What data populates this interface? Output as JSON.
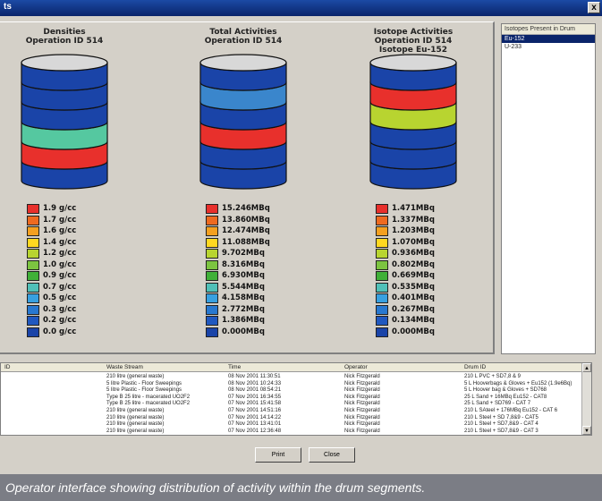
{
  "window": {
    "title": "ts",
    "close_label": "x"
  },
  "colors": {
    "drum_blue": "#1a44a8",
    "teal": "#55c8a0",
    "red": "#e8302c",
    "light_blue": "#3a86cc",
    "yellow_green": "#b8d430",
    "scale": [
      "#e8302c",
      "#ee6a20",
      "#f4a020",
      "#ffd820",
      "#b8d430",
      "#7cc440",
      "#40b038",
      "#50c0b8",
      "#38a0e0",
      "#2878d0",
      "#2058c0",
      "#1a44a8"
    ]
  },
  "charts": [
    {
      "title_lines": [
        "Densities",
        "Operation ID 514"
      ],
      "segment_colors": [
        "#1a44a8",
        "#1a44a8",
        "#1a44a8",
        "#55c8a0",
        "#e8302c",
        "#1a44a8"
      ],
      "legend": [
        "1.9 g/cc",
        "1.7 g/cc",
        "1.6 g/cc",
        "1.4 g/cc",
        "1.2 g/cc",
        "1.0 g/cc",
        "0.9 g/cc",
        "0.7 g/cc",
        "0.5 g/cc",
        "0.3 g/cc",
        "0.2 g/cc",
        "0.0 g/cc"
      ]
    },
    {
      "title_lines": [
        "Total Activities",
        "Operation ID 514"
      ],
      "segment_colors": [
        "#1a44a8",
        "#3a86cc",
        "#1a44a8",
        "#e8302c",
        "#1a44a8",
        "#1a44a8"
      ],
      "legend": [
        "15.246MBq",
        "13.860MBq",
        "12.474MBq",
        "11.088MBq",
        "9.702MBq",
        "8.316MBq",
        "6.930MBq",
        "5.544MBq",
        "4.158MBq",
        "2.772MBq",
        "1.386MBq",
        "0.000MBq"
      ]
    },
    {
      "title_lines": [
        "Isotope Activities",
        "Operation ID 514",
        "Isotope Eu-152"
      ],
      "segment_colors": [
        "#1a44a8",
        "#e8302c",
        "#b8d430",
        "#1a44a8",
        "#1a44a8",
        "#1a44a8"
      ],
      "legend": [
        "1.471MBq",
        "1.337MBq",
        "1.203MBq",
        "1.070MBq",
        "0.936MBq",
        "0.802MBq",
        "0.669MBq",
        "0.535MBq",
        "0.401MBq",
        "0.267MBq",
        "0.134MBq",
        "0.000MBq"
      ]
    }
  ],
  "isotopes": {
    "header": "Isotopes Present in Drum",
    "items": [
      "Eu-152",
      "U-233"
    ],
    "selected": 0
  },
  "table": {
    "columns": [
      "ID",
      "Waste Stream",
      "Time",
      "Operator",
      "Drum ID"
    ],
    "rows": [
      [
        "",
        "210 litre (general waste)",
        "08 Nov 2001 11:30:51",
        "Nick Fitzgerald",
        "210 L PVC + SD7,8 & 9"
      ],
      [
        "",
        "5 litre Plastic - Floor Sweepings",
        "08 Nov 2001 10:24:33",
        "Nick Fitzgerald",
        "5 L Hooverbags & Gloves + Eu152 (1.9e6Bq)"
      ],
      [
        "",
        "5 litre Plastic - Floor Sweepings",
        "08 Nov 2001 08:54:21",
        "Nick Fitzgerald",
        "5 L Hoover bag & Gloves + SD768"
      ],
      [
        "",
        "Type B 25 litre - macerated UO2F2",
        "07 Nov 2001 16:34:55",
        "Nick Fitzgerald",
        "25 L Sand + 16MBq Eu152 - CAT8"
      ],
      [
        "",
        "Type B 25 litre - macerated UO2F2",
        "07 Nov 2001 15:41:58",
        "Nick Fitzgerald",
        "25 L Sand + SD769 - CAT 7"
      ],
      [
        "",
        "210 litre (general waste)",
        "07 Nov 2001 14:51:16",
        "Nick Fitzgerald",
        "210 L SAteel + 176MBq Eu152 - CAT 6"
      ],
      [
        "",
        "210 litre (general waste)",
        "07 Nov 2001 14:14:22",
        "Nick Fitzgerald",
        "210 L Steel + SD 7,8&9 - CAT5"
      ],
      [
        "",
        "210 litre (general waste)",
        "07 Nov 2001 13:41:01",
        "Nick Fitzgerald",
        "210 L Steel + SD7,8&9 - CAT 4"
      ],
      [
        "",
        "210 litre (general waste)",
        "07 Nov 2001 12:36:48",
        "Nick Fitzgerald",
        "210 L Steel + SD7,8&9 - CAT 3"
      ]
    ]
  },
  "buttons": {
    "print": "Print",
    "close": "Close"
  },
  "caption": "Operator interface showing distribution of activity within the drum segments."
}
